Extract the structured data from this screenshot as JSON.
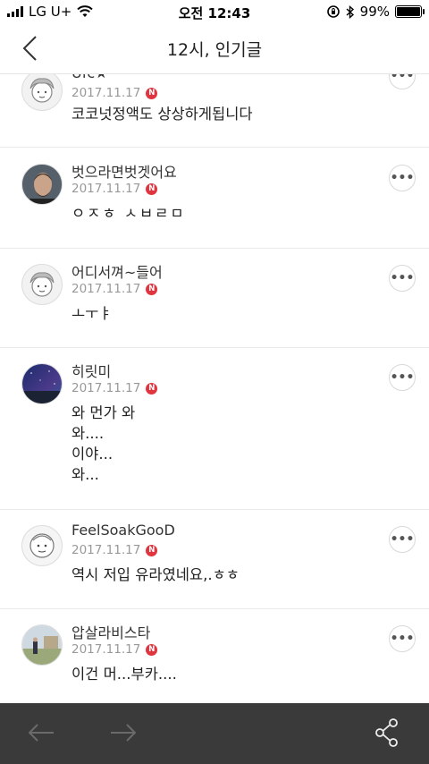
{
  "status_bar": {
    "carrier": "LG U+",
    "time": "오전 12:43",
    "battery": "99%",
    "battery_level": 0.99
  },
  "header": {
    "title": "12시, 인기글"
  },
  "posts": [
    {
      "name": "Ufc★",
      "date": "2017.11.17",
      "badge": "N",
      "content": "코코넛정액도 상상하게됩니다",
      "avatar_icon": "sketch-character-icon"
    },
    {
      "name": "벗으라면벗겟어요",
      "date": "2017.11.17",
      "badge": "N",
      "content": "ㅇㅈㅎ ㅅㅂㄹㅁ",
      "avatar_icon": "profile-photo"
    },
    {
      "name": "어디서껴~들어",
      "date": "2017.11.17",
      "badge": "N",
      "content": "ㅗㅜㅑ",
      "avatar_icon": "sketch-character-icon"
    },
    {
      "name": "히릿미",
      "date": "2017.11.17",
      "badge": "N",
      "content": "와 먼가 와\n와....\n이야...\n와...",
      "avatar_icon": "night-sky-photo"
    },
    {
      "name": "FeelSoakGooD",
      "date": "2017.11.17",
      "badge": "N",
      "content": "역시 저입 유라였네요,.ㅎㅎ",
      "avatar_icon": "illustration-avatar"
    },
    {
      "name": "압살라비스타",
      "date": "2017.11.17",
      "badge": "N",
      "content": "이건 머...부카....",
      "avatar_icon": "landscape-photo"
    }
  ],
  "more_label": "•••",
  "colors": {
    "badge": "#e0353f",
    "bottom_bar": "#3a3a3a"
  }
}
